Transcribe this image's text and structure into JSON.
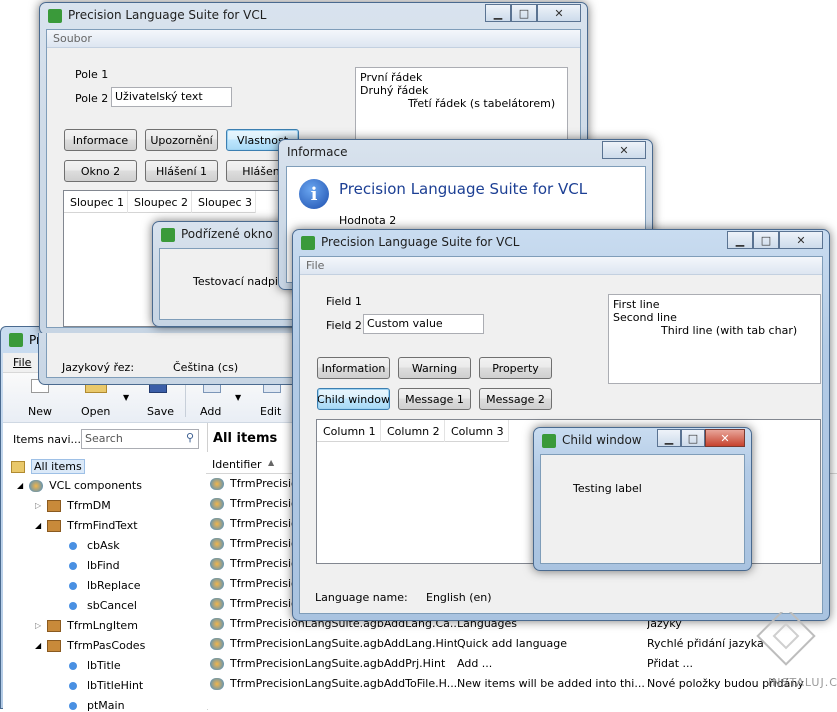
{
  "czech_window": {
    "title": "Precision Language Suite for VCL",
    "menu": "Soubor",
    "field1_label": "Pole 1",
    "field2_label": "Pole 2",
    "field2_value": "Uživatelský text",
    "memo_lines": [
      "První řádek",
      "Druhý řádek",
      "Třetí řádek (s tabelátorem)"
    ],
    "buttons": [
      "Informace",
      "Upozornění",
      "Vlastnost",
      "Okno 2",
      "Hlášení 1",
      "Hlášení"
    ],
    "columns": [
      "Sloupec 1",
      "Sloupec 2",
      "Sloupec 3"
    ],
    "language_label": "Jazykový řez:",
    "language_value": "Čeština (cs)"
  },
  "czech_child": {
    "title": "Podřízené okno",
    "label": "Testovací nadpis"
  },
  "info_dialog": {
    "title": "Informace",
    "heading": "Precision Language Suite for VCL",
    "text": "Hodnota 2"
  },
  "english_window": {
    "title": "Precision Language Suite for VCL",
    "menu": "File",
    "field1_label": "Field 1",
    "field2_label": "Field 2",
    "field2_value": "Custom value",
    "memo_lines": [
      "First line",
      "Second line",
      "Third line (with tab char)"
    ],
    "buttons": [
      "Information",
      "Warning",
      "Property",
      "Child window",
      "Message 1",
      "Message 2"
    ],
    "columns": [
      "Column 1",
      "Column 2",
      "Column 3"
    ],
    "language_label": "Language name:",
    "language_value": "English (en)"
  },
  "english_child": {
    "title": "Child window",
    "label": "Testing label"
  },
  "explorer": {
    "title": "Pr",
    "menu_file": "File",
    "toolbar": [
      "New",
      "Open",
      "Save",
      "Add",
      "Edit"
    ],
    "nav_label": "Items navi...",
    "search_placeholder": "Search",
    "all_items_header": "All items",
    "identifier_header": "Identifier",
    "tree": [
      {
        "label": "All items",
        "level": 0
      },
      {
        "label": "VCL components",
        "level": 1
      },
      {
        "label": "TfrmDM",
        "level": 2
      },
      {
        "label": "TfrmFindText",
        "level": 2
      },
      {
        "label": "cbAsk",
        "level": 3
      },
      {
        "label": "lbFind",
        "level": 3
      },
      {
        "label": "lbReplace",
        "level": 3
      },
      {
        "label": "sbCancel",
        "level": 3
      },
      {
        "label": "TfrmLngItem",
        "level": 2
      },
      {
        "label": "TfrmPasCodes",
        "level": 2
      },
      {
        "label": "lbTitle",
        "level": 3
      },
      {
        "label": "lbTitleHint",
        "level": 3
      },
      {
        "label": "ptMain",
        "level": 3
      }
    ],
    "rows": [
      {
        "id": "TfrmPrecisio",
        "en": "",
        "cs": ""
      },
      {
        "id": "TfrmPrecisio",
        "en": "",
        "cs": ""
      },
      {
        "id": "TfrmPrecisio",
        "en": "",
        "cs": ""
      },
      {
        "id": "TfrmPrecisio",
        "en": "",
        "cs": ""
      },
      {
        "id": "TfrmPrecisio",
        "en": "",
        "cs": ""
      },
      {
        "id": "TfrmPrecisio",
        "en": "",
        "cs": ""
      },
      {
        "id": "TfrmPrecisio",
        "en": "",
        "cs": ""
      },
      {
        "id": "TfrmPrecisionLangSuite.agbAddLang.Ca...",
        "en": "Languages",
        "cs": "Jazyky"
      },
      {
        "id": "TfrmPrecisionLangSuite.agbAddLang.Hint",
        "en": "Quick add language",
        "cs": "Rychlé přidání jazyka"
      },
      {
        "id": "TfrmPrecisionLangSuite.agbAddPrj.Hint",
        "en": "Add ...",
        "cs": "Přidat ..."
      },
      {
        "id": "TfrmPrecisionLangSuite.agbAddToFile.H...",
        "en": "New items will be added into thi...",
        "cs": "Nové položky budou přidány"
      }
    ]
  },
  "watermark": "INSTALUJ.CZ"
}
